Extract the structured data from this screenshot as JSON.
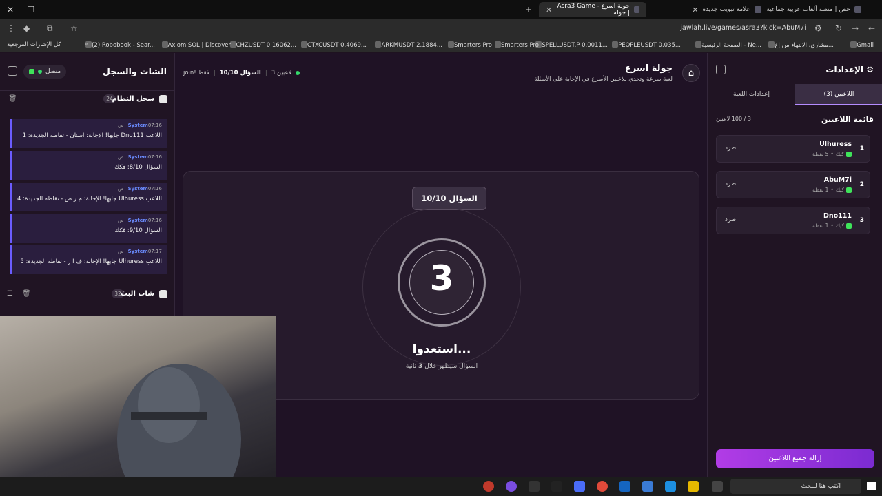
{
  "browser": {
    "tabs": [
      {
        "title": "خص | منصة ألعاب عربية جماعية"
      },
      {
        "title": "علامة تبويب جديدة"
      },
      {
        "title": "جولة اسرع - Asra3 Game | جوله"
      }
    ],
    "url": "jawlah.live/games/asra3?kick=AbuM7i",
    "bookmarks": [
      "Gmail",
      "مشاري، الانتهاء من إع...",
      "الصفحة الرئيسية - Ne...",
      "PEOPLEUSDT 0.035...",
      "SPELLUSDT.P 0.0011...",
      "Smarters Pro",
      "Smarters Pro",
      "ARKMUSDT 2.1884...",
      "CTXCUSDT 0.4069...",
      "CHZUSDT 0.16062...",
      "Axiom SOL | Discover",
      "(2) Robobook - Sear...",
      "كل الإشارات المرجعية"
    ]
  },
  "left_panel": {
    "title": "الشات والسجل",
    "status": "متصل",
    "system_log": {
      "title": "سجل النظام",
      "count": "24",
      "messages": [
        {
          "sender": "System",
          "time": "07:16 ص",
          "text": "اللاعب Dno111 جابها! الإجابة: اسنان - نقاطه الجديدة: 1"
        },
        {
          "sender": "System",
          "time": "07:16 ص",
          "text": "السؤال 8/10: فكك"
        },
        {
          "sender": "System",
          "time": "07:16 ص",
          "text": "اللاعب Ulhuress جابها! الإجابة: م ر ض - نقاطه الجديدة: 4"
        },
        {
          "sender": "System",
          "time": "07:16 ص",
          "text": "السؤال 9/10: فكك"
        },
        {
          "sender": "System",
          "time": "07:17 ص",
          "text": "اللاعب Ulhuress جابها! الإجابة: ف ا ر - نقاطه الجديدة: 5"
        }
      ]
    },
    "stream_chat": {
      "title": "شات البث",
      "count": "32"
    }
  },
  "game": {
    "title": "جولة اسرع",
    "subtitle": "لعبة سرعة وتحدي للاعبين الأسرع في الإجابة على الأسئلة",
    "players_online": "3 لاعبين",
    "question_progress": "السؤال 10/10",
    "join_mode": "join! فقط",
    "question_badge": "السؤال 10/10",
    "countdown": "3",
    "ready_text": "استعدوا...",
    "ready_sub_prefix": "السؤال سيظهر خلال",
    "ready_sub_seconds": "3",
    "ready_sub_unit": "ثانية"
  },
  "right_panel": {
    "title": "الإعدادات",
    "tabs": [
      {
        "label": "اللاعبين (3)"
      },
      {
        "label": "إعدادات اللعبة"
      }
    ],
    "list_title": "قائمة اللاعبين",
    "list_count": "3 / 100 لاعبين",
    "players": [
      {
        "rank": "1",
        "name": "Ulhuress",
        "platform": "كيك",
        "points": "5 نقطة",
        "kick_label": "طرد"
      },
      {
        "rank": "2",
        "name": "AbuM7i",
        "platform": "كيك",
        "points": "1 نقطة",
        "kick_label": "طرد"
      },
      {
        "rank": "3",
        "name": "Dno111",
        "platform": "كيك",
        "points": "1 نقطة",
        "kick_label": "طرد"
      }
    ],
    "remove_all": "إزالة جميع اللاعبين"
  },
  "taskbar": {
    "search_placeholder": "اكتب هنا للبحث"
  },
  "colors": {
    "accent": "#b23ce6",
    "online": "#35d96b",
    "kick": "#3fe35a",
    "system": "#6b8cff"
  }
}
